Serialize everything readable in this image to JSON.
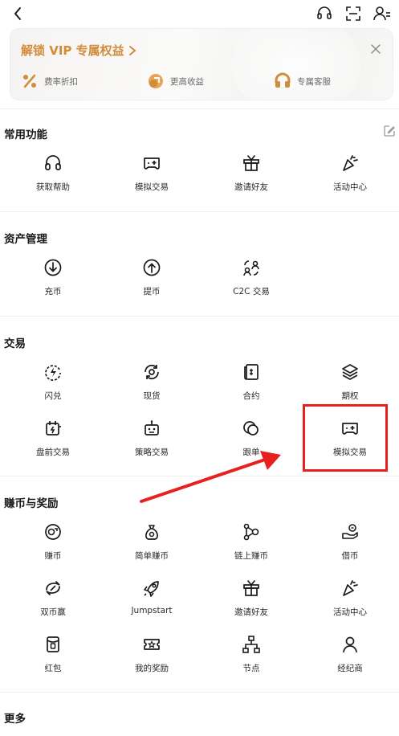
{
  "vip": {
    "title": "解锁 VIP 专属权益",
    "perks": [
      {
        "label": "费率折扣",
        "icon": "percent-icon"
      },
      {
        "label": "更高收益",
        "icon": "yield-icon"
      },
      {
        "label": "专属客服",
        "icon": "headset-icon"
      }
    ]
  },
  "sections": {
    "common": {
      "title": "常用功能",
      "items": [
        {
          "label": "获取帮助",
          "icon": "headphones-icon"
        },
        {
          "label": "模拟交易",
          "icon": "demo-trade-icon"
        },
        {
          "label": "邀请好友",
          "icon": "gift-icon"
        },
        {
          "label": "活动中心",
          "icon": "party-popper-icon"
        }
      ]
    },
    "assets": {
      "title": "资产管理",
      "items": [
        {
          "label": "充币",
          "icon": "deposit-icon"
        },
        {
          "label": "提币",
          "icon": "withdraw-icon"
        },
        {
          "label": "C2C 交易",
          "icon": "c2c-icon"
        }
      ]
    },
    "trade": {
      "title": "交易",
      "items": [
        {
          "label": "闪兑",
          "icon": "flash-swap-icon"
        },
        {
          "label": "现货",
          "icon": "spot-icon"
        },
        {
          "label": "合约",
          "icon": "contract-icon"
        },
        {
          "label": "期权",
          "icon": "options-layers-icon"
        },
        {
          "label": "盘前交易",
          "icon": "pre-market-icon"
        },
        {
          "label": "策略交易",
          "icon": "robot-icon"
        },
        {
          "label": "跟单",
          "icon": "copy-trade-icon"
        },
        {
          "label": "模拟交易",
          "icon": "demo-trade-icon"
        }
      ]
    },
    "earn": {
      "title": "赚币与奖励",
      "items": [
        {
          "label": "赚币",
          "icon": "earn-coin-icon"
        },
        {
          "label": "简单赚币",
          "icon": "money-bag-icon"
        },
        {
          "label": "链上赚币",
          "icon": "onchain-icon"
        },
        {
          "label": "借币",
          "icon": "loan-icon"
        },
        {
          "label": "双币赢",
          "icon": "dual-coin-icon"
        },
        {
          "label": "Jumpstart",
          "icon": "rocket-icon"
        },
        {
          "label": "邀请好友",
          "icon": "gift-icon"
        },
        {
          "label": "活动中心",
          "icon": "party-popper-icon"
        },
        {
          "label": "红包",
          "icon": "red-packet-icon"
        },
        {
          "label": "我的奖励",
          "icon": "ticket-icon"
        },
        {
          "label": "节点",
          "icon": "node-icon"
        },
        {
          "label": "经纪商",
          "icon": "person-icon"
        }
      ]
    },
    "more": {
      "title": "更多"
    }
  },
  "colors": {
    "vip_accent": "#d18c3a",
    "highlight": "#e82020"
  }
}
